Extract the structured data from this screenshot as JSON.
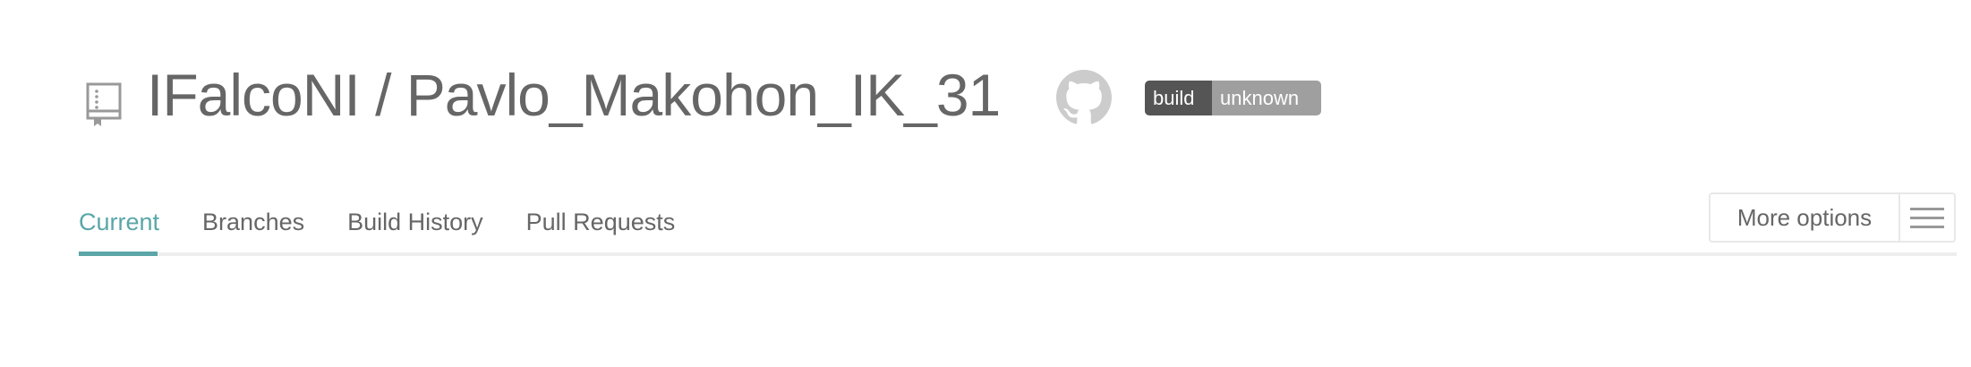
{
  "header": {
    "owner": "IFalcoNI",
    "separator": " / ",
    "repo": "Pavlo_Makohon_IK_31",
    "icons": [
      "repo-icon",
      "github-icon"
    ],
    "badge": {
      "label": "build",
      "status": "unknown",
      "label_color": "#555555",
      "status_color": "#9f9f9f"
    }
  },
  "tabs": [
    {
      "label": "Current",
      "active": true
    },
    {
      "label": "Branches",
      "active": false
    },
    {
      "label": "Build History",
      "active": false
    },
    {
      "label": "Pull Requests",
      "active": false
    }
  ],
  "more_options": {
    "label": "More options",
    "icon": "hamburger-icon"
  },
  "colors": {
    "accent": "#5aa6a8",
    "text": "#666666"
  }
}
